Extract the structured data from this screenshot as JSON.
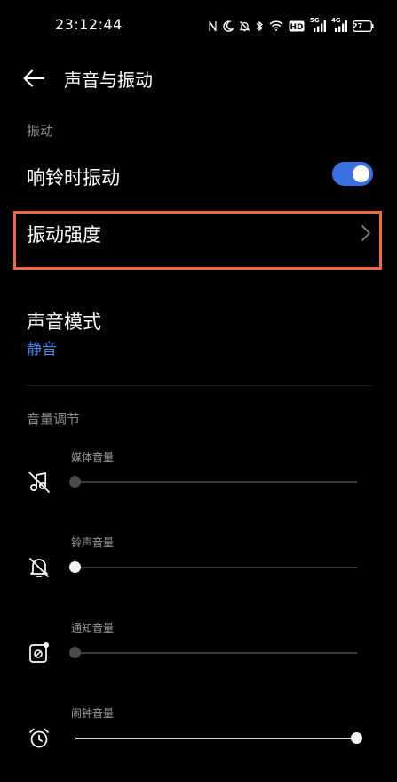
{
  "status_bar": {
    "time": "23:12:44",
    "network_5g": "5G",
    "network_4g": "4G",
    "battery": "27",
    "hd_badge": "HD"
  },
  "header": {
    "title": "声音与振动"
  },
  "vibration": {
    "section_label": "振动",
    "ring_vibrate_label": "响铃时振动",
    "ring_vibrate_on": true,
    "intensity_label": "振动强度"
  },
  "sound_mode": {
    "label": "声音模式",
    "value": "静音"
  },
  "volume": {
    "section_label": "音量调节",
    "items": [
      {
        "label": "媒体音量",
        "level": 0,
        "icon": "music-off-icon",
        "enabled": false
      },
      {
        "label": "铃声音量",
        "level": 0,
        "icon": "bell-off-icon",
        "enabled": true
      },
      {
        "label": "通知音量",
        "level": 0,
        "icon": "notification-icon",
        "enabled": false
      },
      {
        "label": "闹钟音量",
        "level": 1,
        "icon": "alarm-icon",
        "enabled": true
      }
    ]
  },
  "colors": {
    "accent": "#3b70e0",
    "highlight": "#f06a3f",
    "link": "#4a86ee"
  }
}
